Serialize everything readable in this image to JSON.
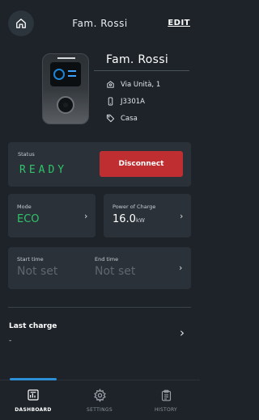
{
  "header": {
    "title": "Fam. Rossi",
    "edit_label": "EDIT"
  },
  "device": {
    "name": "Fam. Rossi",
    "address": "Via Unità, 1",
    "serial": "J3301A",
    "tag": "Casa"
  },
  "status": {
    "label": "Status",
    "value": "READY",
    "disconnect_label": "Disconnect"
  },
  "mode": {
    "label": "Mode",
    "value": "ECO"
  },
  "power": {
    "label": "Power of Charge",
    "value": "16.0",
    "unit": "kW"
  },
  "schedule": {
    "start_label": "Start time",
    "start_value": "Not set",
    "end_label": "End time",
    "end_value": "Not set"
  },
  "last_charge": {
    "label": "Last charge",
    "value": "-"
  },
  "nav": {
    "items": [
      {
        "label": "DASHBOARD",
        "icon": "dashboard-icon",
        "active": true
      },
      {
        "label": "SETTINGS",
        "icon": "gear-icon",
        "active": false
      },
      {
        "label": "HISTORY",
        "icon": "clipboard-icon",
        "active": false
      }
    ]
  },
  "colors": {
    "background": "#1d2329",
    "card": "#2a3138",
    "status_ready": "#2fc46a",
    "disconnect": "#bf2f32",
    "eco": "#2fc46a",
    "accent": "#2d8fd6"
  }
}
